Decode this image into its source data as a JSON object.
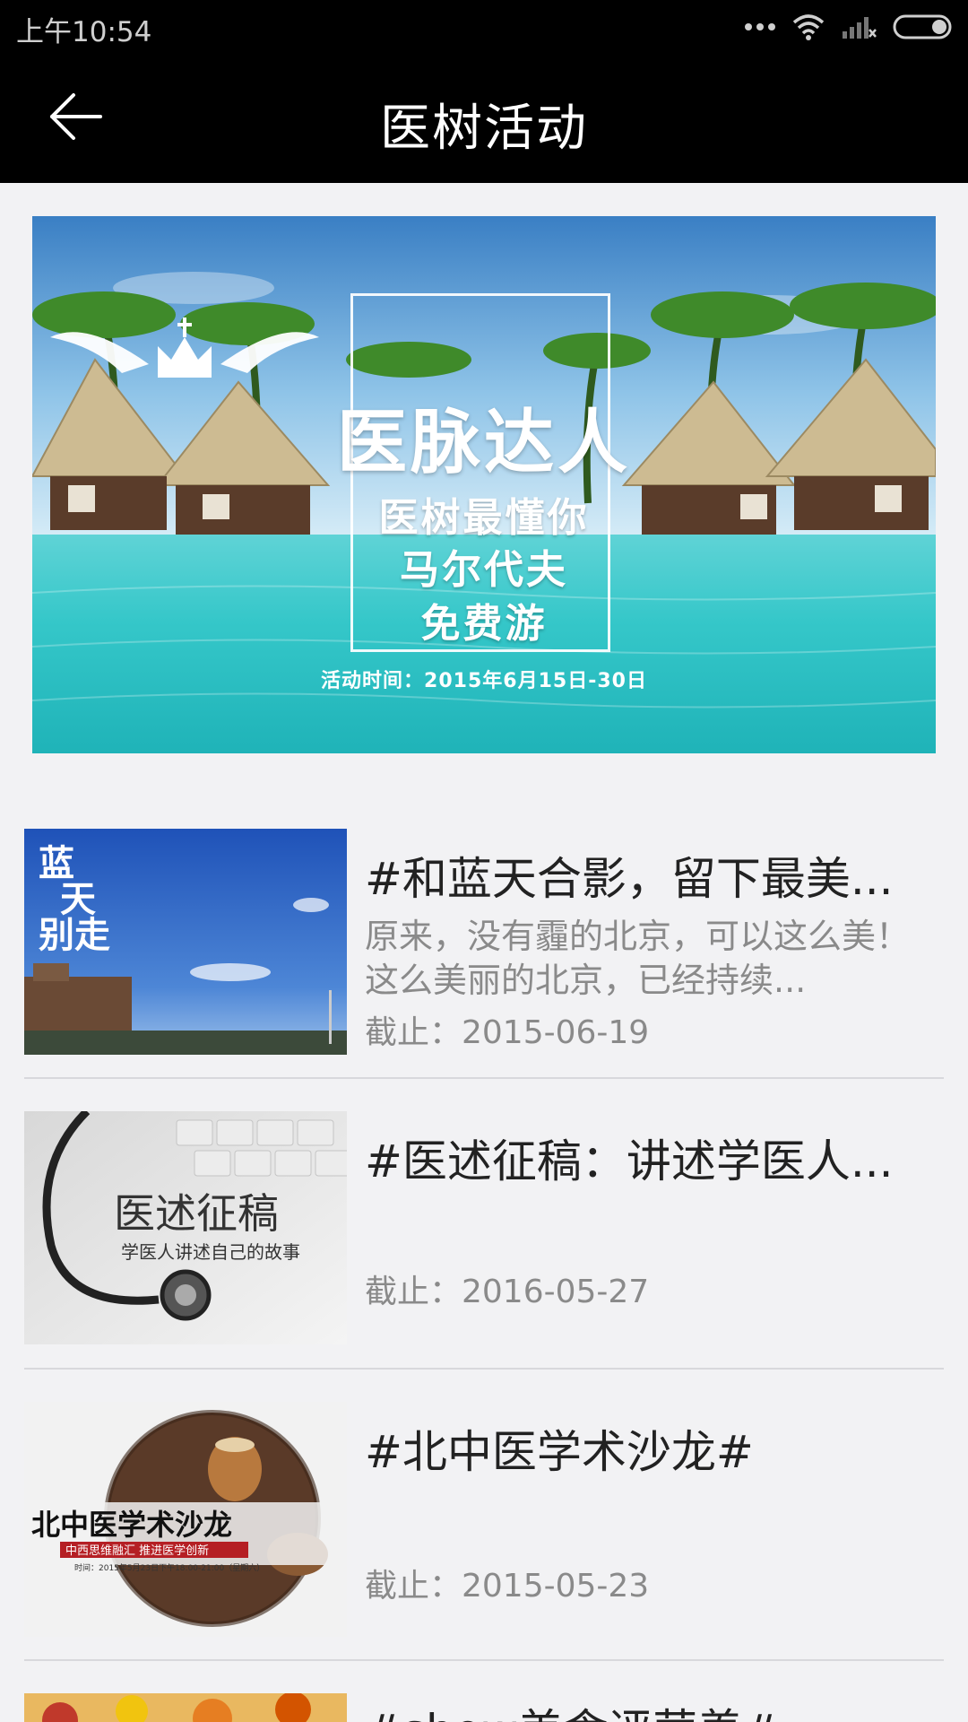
{
  "status_bar": {
    "time": "上午10:54",
    "icons": [
      "more-dots-icon",
      "wifi-icon",
      "signal-icon",
      "battery-icon"
    ]
  },
  "app_bar": {
    "back_icon": "arrow-left-icon",
    "title": "医树活动"
  },
  "banner": {
    "title": "医脉达人",
    "line1": "医树最懂你",
    "line2": "马尔代夫",
    "line3": "免费游",
    "date": "活动时间：2015年6月15日-30日"
  },
  "activities": [
    {
      "title": "#和蓝天合影，留下最美...",
      "desc": "原来，没有霾的北京，可以这么美！这么美丽的北京，已经持续...",
      "deadline": "截止：2015-06-19",
      "thumb_text": "蓝天别走"
    },
    {
      "title": "#医述征稿：讲述学医人...",
      "desc": "",
      "deadline": "截止：2016-05-27",
      "thumb_text": "医述征稿",
      "thumb_sub": "学医人讲述自己的故事"
    },
    {
      "title": "#北中医学术沙龙#",
      "desc": "",
      "deadline": "截止：2015-05-23",
      "thumb_text": "北中医学术沙龙",
      "thumb_sub": "中西思维融汇  推进医学创新",
      "thumb_note": "时间：2015年5月23日下午18:00-21:00（星期六）"
    },
    {
      "title": "#show美食评营养#"
    }
  ],
  "colors": {
    "bar_bg": "#000000",
    "page_bg": "#f2f2f4",
    "title_text": "#222222",
    "secondary_text": "#8a8a8a",
    "divider": "#d8d8dc"
  }
}
